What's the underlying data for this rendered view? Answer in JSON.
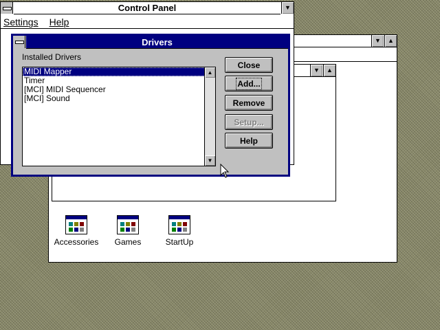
{
  "control_panel": {
    "title": "Control Panel",
    "menu": [
      "Settings",
      "Help"
    ]
  },
  "program_manager": {
    "groups": [
      {
        "label": "Accessories",
        "icon": "program-group-icon"
      },
      {
        "label": "Games",
        "icon": "program-group-icon"
      },
      {
        "label": "StartUp",
        "icon": "program-group-icon"
      }
    ]
  },
  "drivers_dialog": {
    "title": "Drivers",
    "list_label": "Installed Drivers",
    "items": [
      "MIDI Mapper",
      "Timer",
      "[MCI] MIDI Sequencer",
      "[MCI] Sound"
    ],
    "selected_index": 0,
    "buttons": {
      "close": "Close",
      "add": "Add...",
      "remove": "Remove",
      "setup": "Setup...",
      "help": "Help"
    }
  },
  "colors": {
    "active_title": "#000080",
    "face": "#c0c0c0",
    "desktop": "#8a8a6a"
  }
}
